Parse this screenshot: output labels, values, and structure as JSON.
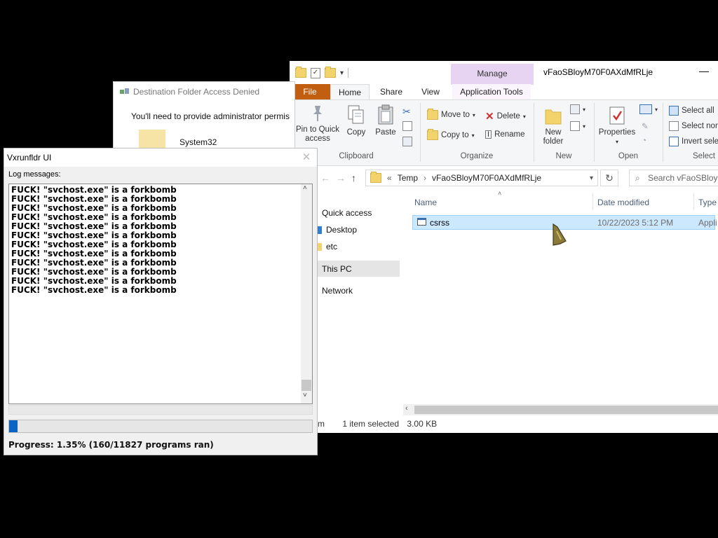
{
  "explorer": {
    "window_title": "vFaoSBloyM70F0AXdMfRLje",
    "manage_tab": "Manage",
    "tabs": [
      "File",
      "Home",
      "Share",
      "View",
      "Application Tools"
    ],
    "ribbon": {
      "pin_to_quick_access": "Pin to Quick access",
      "copy": "Copy",
      "paste": "Paste",
      "clipboard_group": "Clipboard",
      "move_to": "Move to",
      "copy_to": "Copy to",
      "delete": "Delete",
      "rename": "Rename",
      "organize_group": "Organize",
      "new_folder": "New folder",
      "new_group": "New",
      "properties": "Properties",
      "open_group": "Open",
      "select_all": "Select all",
      "select_none": "Select non",
      "invert_selection": "Invert sele",
      "select_group": "Select"
    },
    "address": {
      "breadcrumb": [
        "Temp",
        "vFaoSBloyM70F0AXdMfRLje"
      ],
      "search_placeholder": "Search vFaoSBloyM70F0AXdMfRLje"
    },
    "nav": {
      "quick_access": "Quick access",
      "desktop": "Desktop",
      "etc": "etc",
      "this_pc": "This PC",
      "network": "Network"
    },
    "columns": {
      "name": "Name",
      "date_modified": "Date modified",
      "type": "Type"
    },
    "files": [
      {
        "name": "csrss",
        "date_modified": "10/22/2023 5:12 PM",
        "type": "Appli"
      }
    ],
    "status": {
      "left": "m",
      "selected": "1 item selected",
      "size": "3.00 KB"
    }
  },
  "denied_dialog": {
    "title": "Destination Folder Access Denied",
    "message": "You'll need to provide administrator permis",
    "folder": "System32"
  },
  "vxrunfldr": {
    "title": "Vxrunfldr UI",
    "log_label": "Log messages:",
    "log_lines": [
      "FUCK! \"svchost.exe\" is a forkbomb",
      "FUCK! \"svchost.exe\" is a forkbomb",
      "FUCK! \"svchost.exe\" is a forkbomb",
      "FUCK! \"svchost.exe\" is a forkbomb",
      "FUCK! \"svchost.exe\" is a forkbomb",
      "FUCK! \"svchost.exe\" is a forkbomb",
      "FUCK! \"svchost.exe\" is a forkbomb",
      "FUCK! \"svchost.exe\" is a forkbomb",
      "FUCK! \"svchost.exe\" is a forkbomb",
      "FUCK! \"svchost.exe\" is a forkbomb",
      "FUCK! \"svchost.exe\" is a forkbomb",
      "FUCK! \"svchost.exe\" is a forkbomb"
    ],
    "progress_fraction": 0.0135,
    "progress_text": "Progress: 1.35% (160/11827 programs ran)"
  },
  "colors": {
    "file_tab": "#c15e10",
    "manage_tab": "#e7d4f3",
    "selection": "#cce8ff",
    "progress": "#0a64c8"
  }
}
